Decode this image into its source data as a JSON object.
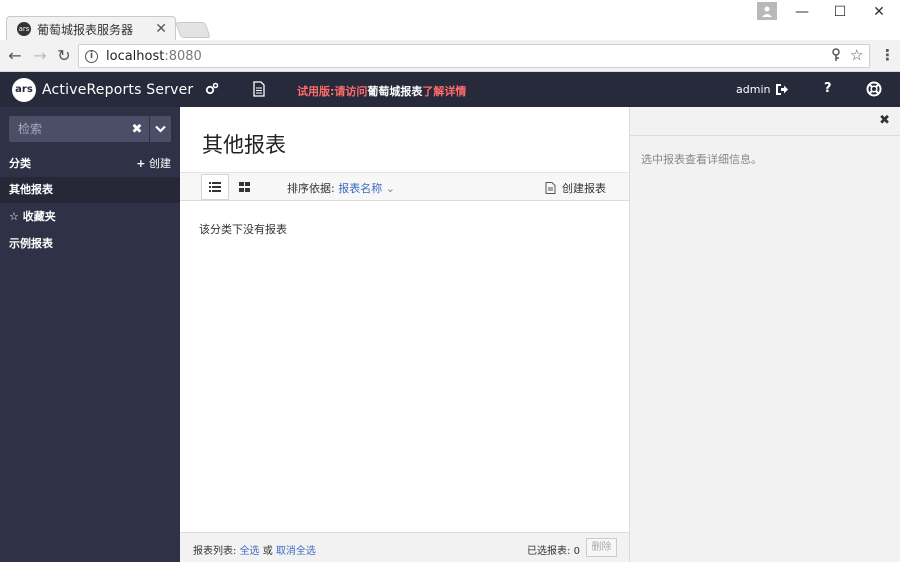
{
  "browser": {
    "tab_title": "葡萄城报表服务器",
    "tab_favicon_text": "ars",
    "url_host": "localhost",
    "url_port": ":8080"
  },
  "header": {
    "logo_text": "ars",
    "app_name": "ActiveReports Server",
    "trial_part1": "试用版:请访问",
    "trial_part2": "葡萄城报表",
    "trial_part3": "了解详情",
    "user": "admin",
    "help": "?"
  },
  "sidebar": {
    "search_placeholder": "检索",
    "category_title": "分类",
    "create_label": "创建",
    "items": [
      {
        "label": "其他报表"
      },
      {
        "label": "☆ 收藏夹"
      },
      {
        "label": "示例报表"
      }
    ]
  },
  "main": {
    "title": "其他报表",
    "sort_label": "排序依据:",
    "sort_value": "报表名称",
    "create_report": "创建报表",
    "empty_message": "该分类下没有报表",
    "footer": {
      "list_label": "报表列表:",
      "select_all": "全选",
      "or": "或",
      "deselect_all": "取消全选",
      "selected_label": "已选报表:",
      "selected_count": "0",
      "delete": "删除"
    }
  },
  "details_panel": {
    "message": "选中报表查看详细信息。"
  },
  "colors": {
    "header_bg": "#262a3b",
    "sidebar_bg": "#2f3246",
    "accent_link": "#3c6ac4",
    "trial_red": "#ff6b6b"
  }
}
